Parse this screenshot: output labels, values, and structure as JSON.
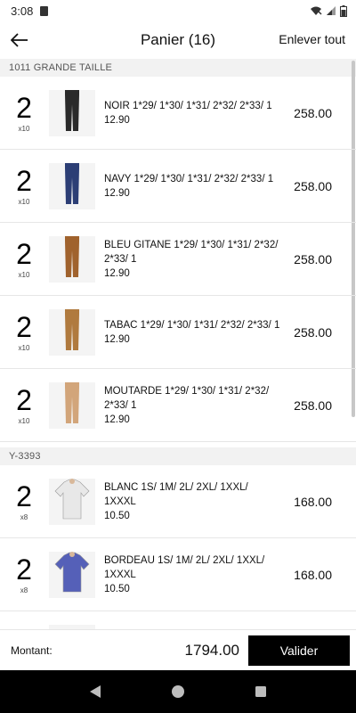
{
  "status_bar": {
    "time": "3:08"
  },
  "app_bar": {
    "title": "Panier (16)",
    "remove_all_label": "Enlever tout"
  },
  "sections": [
    {
      "title": "1011 GRANDE TAILLE",
      "items": [
        {
          "qty": "2",
          "multiplier": "x10",
          "description": "NOIR 1*29/ 1*30/ 1*31/ 2*32/ 2*33/ 1",
          "unit_price": "12.90",
          "total": "258.00",
          "image_icon": "black-pants",
          "color": "#2a2a2a"
        },
        {
          "qty": "2",
          "multiplier": "x10",
          "description": "NAVY 1*29/ 1*30/ 1*31/ 2*32/ 2*33/ 1",
          "unit_price": "12.90",
          "total": "258.00",
          "image_icon": "navy-pants",
          "color": "#2c3e75"
        },
        {
          "qty": "2",
          "multiplier": "x10",
          "description": "BLEU GITANE 1*29/ 1*30/ 1*31/ 2*32/ 2*33/ 1",
          "unit_price": "12.90",
          "total": "258.00",
          "image_icon": "brown-pants",
          "color": "#a0622d"
        },
        {
          "qty": "2",
          "multiplier": "x10",
          "description": "TABAC 1*29/ 1*30/ 1*31/ 2*32/ 2*33/ 1",
          "unit_price": "12.90",
          "total": "258.00",
          "image_icon": "tan-pants",
          "color": "#b07a3e"
        },
        {
          "qty": "2",
          "multiplier": "x10",
          "description": "MOUTARDE 1*29/ 1*30/ 1*31/ 2*32/ 2*33/ 1",
          "unit_price": "12.90",
          "total": "258.00",
          "image_icon": "beige-pants",
          "color": "#d2a57a"
        }
      ]
    },
    {
      "title": "Y-3393",
      "items": [
        {
          "qty": "2",
          "multiplier": "x8",
          "description": "BLANC 1S/ 1M/ 2L/ 2XL/ 1XXL/ 1XXXL",
          "unit_price": "10.50",
          "total": "168.00",
          "image_icon": "white-shirt",
          "color": "#e8e8e8"
        },
        {
          "qty": "2",
          "multiplier": "x8",
          "description": "BORDEAU 1S/ 1M/ 2L/ 2XL/ 1XXL/ 1XXXL",
          "unit_price": "10.50",
          "total": "168.00",
          "image_icon": "blue-shirt",
          "color": "#5560b8"
        }
      ]
    }
  ],
  "footer": {
    "amount_label": "Montant:",
    "amount_value": "1794.00",
    "submit_label": "Valider"
  }
}
